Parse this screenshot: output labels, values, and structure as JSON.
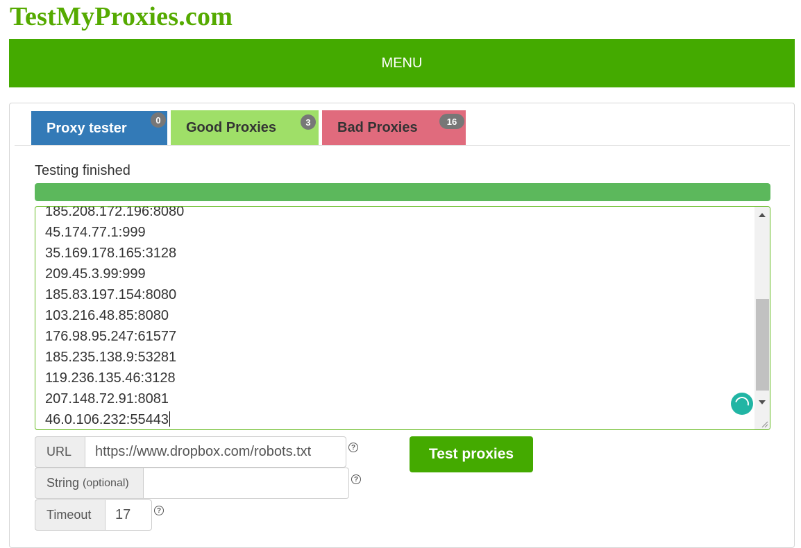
{
  "site": {
    "logo": "TestMyProxies.com"
  },
  "menu": {
    "label": "MENU"
  },
  "tabs": [
    {
      "label": "Proxy tester",
      "badge": "0"
    },
    {
      "label": "Good Proxies",
      "badge": "3"
    },
    {
      "label": "Bad Proxies",
      "badge": "16"
    }
  ],
  "status": {
    "text": "Testing finished",
    "progress": 1.0
  },
  "proxies": {
    "lines": [
      "185.208.172.196:8080",
      "45.174.77.1:999",
      "35.169.178.165:3128",
      "209.45.3.99:999",
      "185.83.197.154:8080",
      "103.216.48.85:8080",
      "176.98.95.247:61577",
      "185.235.138.9:53281",
      "119.236.135.46:3128",
      "207.148.72.91:8081",
      "46.0.106.232:55443"
    ]
  },
  "form": {
    "url_label": "URL",
    "url_value": "https://www.dropbox.com/robots.txt",
    "string_label": "String",
    "string_hint": "(optional)",
    "string_value": "",
    "timeout_label": "Timeout",
    "timeout_value": "17",
    "help": "?",
    "submit_label": "Test proxies"
  },
  "colors": {
    "brand": "#44aa00",
    "tab_active": "#337ab7",
    "tab_good": "#9fdf68",
    "tab_bad": "#e06b7d",
    "progress": "#5cb85c"
  }
}
